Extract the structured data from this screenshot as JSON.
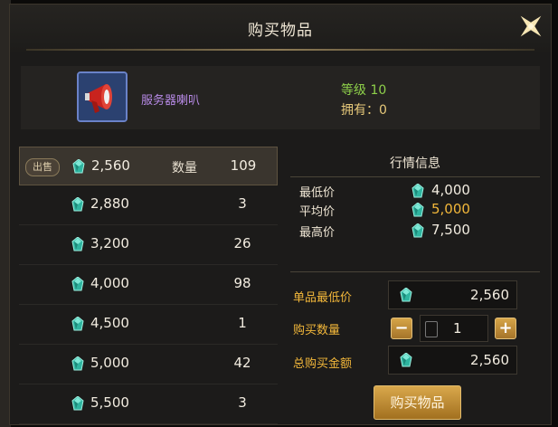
{
  "window": {
    "title": "购买物品"
  },
  "item": {
    "name": "服务器喇叭",
    "level": "等级 10",
    "owned": "拥有：0"
  },
  "listing": {
    "sell_badge": "出售",
    "qty_label": "数量",
    "rows": [
      {
        "price": "2,560",
        "qty": "109"
      },
      {
        "price": "2,880",
        "qty": "3"
      },
      {
        "price": "3,200",
        "qty": "26"
      },
      {
        "price": "4,000",
        "qty": "98"
      },
      {
        "price": "4,500",
        "qty": "1"
      },
      {
        "price": "5,000",
        "qty": "42"
      },
      {
        "price": "5,500",
        "qty": "3"
      }
    ]
  },
  "market": {
    "title": "行情信息",
    "min_label": "最低价",
    "min_value": "4,000",
    "avg_label": "平均价",
    "avg_value": "5,000",
    "max_label": "最高价",
    "max_value": "7,500"
  },
  "form": {
    "unit_price_label": "单品最低价",
    "unit_price_value": "2,560",
    "quantity_label": "购买数量",
    "quantity_value": "1",
    "minus": "−",
    "plus": "+",
    "total_label": "总购买金额",
    "total_value": "2,560"
  },
  "buy_button": "购买物品",
  "colors": {
    "accent_gold": "#f2b73a",
    "name_purple": "#b78ae6",
    "level_green": "#8ed04a",
    "currency": "#3fc7b0"
  }
}
